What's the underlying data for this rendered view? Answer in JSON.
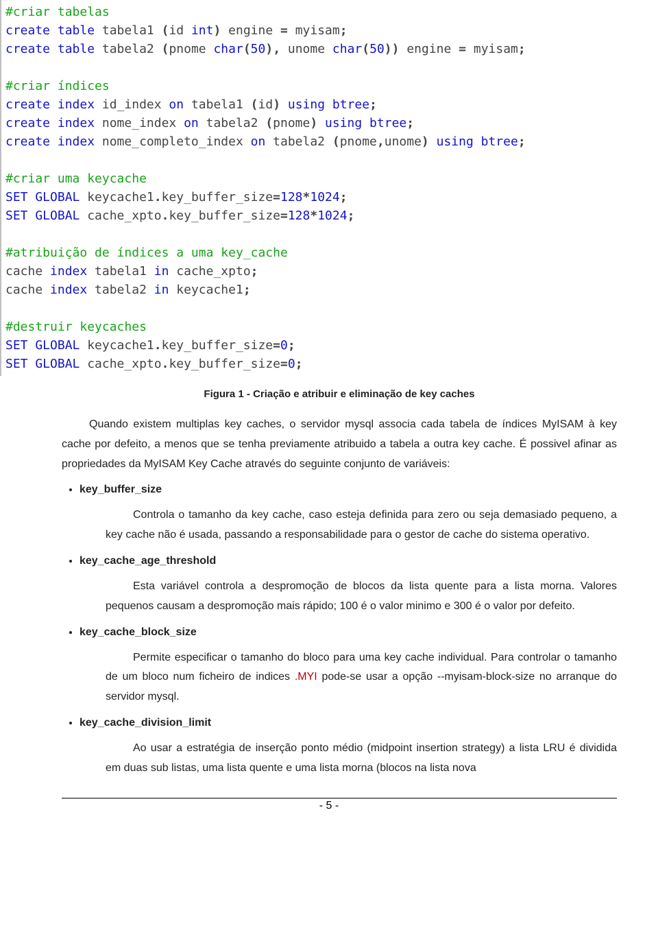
{
  "code": {
    "c1": "#criar tabelas",
    "l1a": "create table",
    "l1b": " tabela1 ",
    "l1c": "(",
    "l1d": "id ",
    "l1e": "int",
    "l1f": ")",
    "l1g": " engine ",
    "l1h": "=",
    "l1i": " myisam",
    "l1j": ";",
    "l2a": "create table",
    "l2b": " tabela2 ",
    "l2c": "(",
    "l2d": "pnome ",
    "l2e": "char",
    "l2f": "(",
    "l2g": "50",
    "l2h": "),",
    "l2i": " unome ",
    "l2j": "char",
    "l2k": "(",
    "l2l": "50",
    "l2m": "))",
    "l2n": " engine ",
    "l2o": "=",
    "l2p": " myisam",
    "l2q": ";",
    "c2": "#criar índices",
    "l3a": "create index",
    "l3b": " id_index ",
    "l3c": "on",
    "l3d": " tabela1 ",
    "l3e": "(",
    "l3f": "id",
    "l3g": ")",
    "l3h": " using btree",
    "l3i": ";",
    "l4a": "create index",
    "l4b": " nome_index ",
    "l4c": "on",
    "l4d": " tabela2 ",
    "l4e": "(",
    "l4f": "pnome",
    "l4g": ")",
    "l4h": " using btree",
    "l4i": ";",
    "l5a": "create index",
    "l5b": " nome_completo_index ",
    "l5c": "on",
    "l5d": " tabela2 ",
    "l5e": "(",
    "l5f": "pnome",
    "l5g": ",",
    "l5h": "unome",
    "l5i": ")",
    "l5j": " using btree",
    "l5k": ";",
    "c3": "#criar uma keycache",
    "l6a": "SET GLOBAL",
    "l6b": " keycache1",
    "l6c": ".",
    "l6d": "key_buffer_size",
    "l6e": "=",
    "l6f": "128",
    "l6g": "*",
    "l6h": "1024",
    "l6i": ";",
    "l7a": "SET GLOBAL",
    "l7b": " cache_xpto",
    "l7c": ".",
    "l7d": "key_buffer_size",
    "l7e": "=",
    "l7f": "128",
    "l7g": "*",
    "l7h": "1024",
    "l7i": ";",
    "c4": "#atribuição de índices a uma key_cache",
    "l8a": "cache ",
    "l8b": "index",
    "l8c": " tabela1 ",
    "l8d": "in",
    "l8e": " cache_xpto",
    "l8f": ";",
    "l9a": "cache ",
    "l9b": "index",
    "l9c": " tabela2 ",
    "l9d": "in",
    "l9e": " keycache1",
    "l9f": ";",
    "c5": "#destruir keycaches",
    "l10a": "SET GLOBAL",
    "l10b": " keycache1",
    "l10c": ".",
    "l10d": "key_buffer_size",
    "l10e": "=",
    "l10f": "0",
    "l10g": ";",
    "l11a": "SET GLOBAL",
    "l11b": " cache_xpto",
    "l11c": ".",
    "l11d": "key_buffer_size",
    "l11e": "=",
    "l11f": "0",
    "l11g": ";"
  },
  "caption": "Figura 1 - Criação e atribuir e eliminação de key caches",
  "para1": "Quando existem multiplas key caches, o servidor mysql associa cada tabela de índices MyISAM à key cache por defeito, a menos que se tenha previamente atribuido a tabela a outra key cache. É possivel afinar as propriedades da MyISAM Key Cache através do seguinte conjunto de variáveis:",
  "vars": {
    "v1": {
      "name": "key_buffer_size",
      "desc": "Controla o tamanho da key cache, caso esteja definida para zero ou seja demasiado pequeno, a key cache não é usada, passando a responsabilidade para o gestor de cache do sistema operativo."
    },
    "v2": {
      "name": "key_cache_age_threshold",
      "desc": "Esta variável controla a despromoção de blocos da lista quente para a lista morna. Valores pequenos causam a despromoção mais rápido; 100 é o valor minimo e 300 é o valor por defeito."
    },
    "v3": {
      "name": "key_cache_block_size",
      "desc_a": "Permite especificar o tamanho do bloco para uma key cache individual. Para controlar o tamanho de um bloco num ficheiro de indices ",
      "myi": ".MYI",
      "desc_b": " pode-se usar a opção --myisam-block-size no arranque do servidor mysql."
    },
    "v4": {
      "name": "key_cache_division_limit",
      "desc": "Ao usar a estratégia de inserção ponto médio (midpoint insertion strategy) a lista LRU é dividida em duas sub listas, uma lista quente e uma lista morna (blocos na lista nova"
    }
  },
  "page": "- 5 -"
}
